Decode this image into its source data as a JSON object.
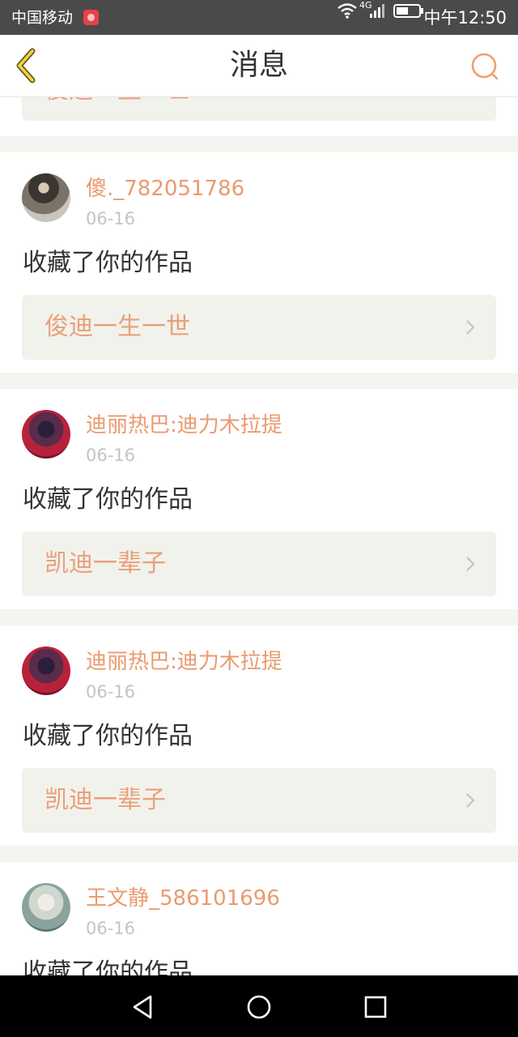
{
  "status_bar": {
    "carrier": "中国移动",
    "network": "4G",
    "time": "中午12:50"
  },
  "header": {
    "title": "消息",
    "back_icon": "chevron-left-icon",
    "search_icon": "search-icon"
  },
  "colors": {
    "accent": "#ea9a6e",
    "item_bg": "#f2f2ec",
    "page_bg": "#f4f4f1",
    "status_bar_bg": "#4a4a4a"
  },
  "messages": [
    {
      "item": "俊迪一生一世"
    },
    {
      "username": "傻._782051786",
      "date": "06-16",
      "action": "收藏了你的作品",
      "item": "俊迪一生一世"
    },
    {
      "username": "迪丽热巴:迪力木拉提",
      "date": "06-16",
      "action": "收藏了你的作品",
      "item": "凯迪一辈子"
    },
    {
      "username": "迪丽热巴:迪力木拉提",
      "date": "06-16",
      "action": "收藏了你的作品",
      "item": "凯迪一辈子"
    },
    {
      "username": "王文静_586101696",
      "date": "06-16",
      "action": "收藏了你的作品"
    }
  ],
  "nav_bar": {
    "back_icon": "triangle-back-icon",
    "home_icon": "circle-home-icon",
    "recent_icon": "square-recent-icon"
  }
}
